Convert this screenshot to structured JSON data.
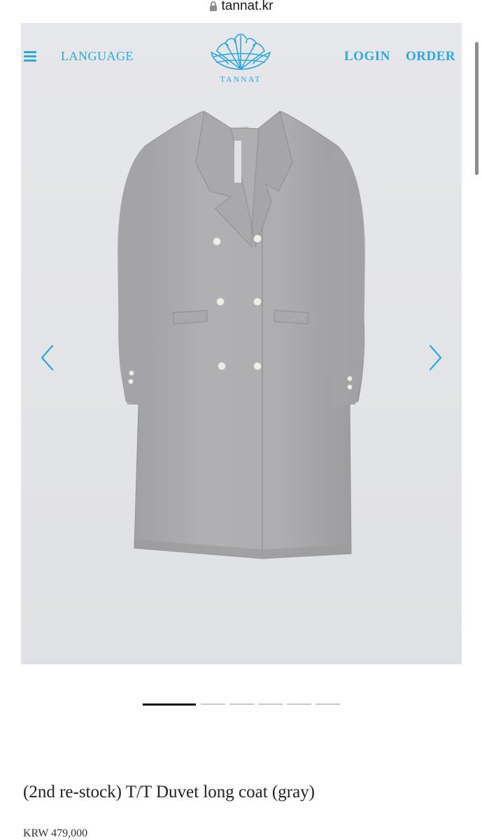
{
  "browser": {
    "url": "tannat.kr"
  },
  "header": {
    "language_label": "LANGUAGE",
    "login_label": "LOGIN",
    "order_label": "ORDER",
    "logo_text": "TANNAT",
    "menu_icon": "hamburger-menu-icon"
  },
  "gallery": {
    "slide_count": 6,
    "active_slide": 1,
    "prev_icon": "chevron-left-icon",
    "next_icon": "chevron-right-icon",
    "accent_color": "#2aa8df"
  },
  "product": {
    "title": "(2nd re-stock) T/T Duvet long coat (gray)",
    "price": "KRW 479,000"
  }
}
